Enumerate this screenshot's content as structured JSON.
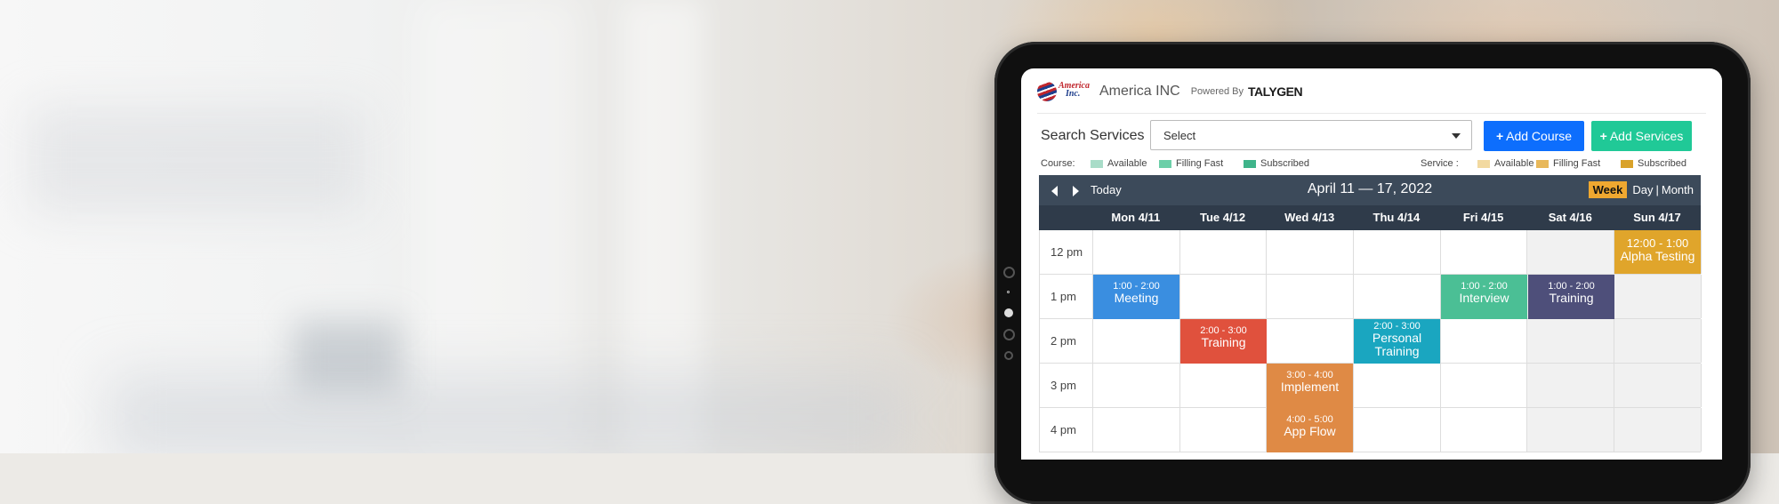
{
  "app": {
    "company": "America INC",
    "logo_top": "America",
    "logo_bottom": "Inc.",
    "powered_by": "Powered By",
    "brand": "TALYGEN"
  },
  "search": {
    "label": "Search Services",
    "select_value": "Select"
  },
  "buttons": {
    "add_course": "Add Course",
    "add_services": "Add Services",
    "plus": "+"
  },
  "legend": {
    "course_label": "Course:",
    "service_label": "Service :",
    "course_items": [
      {
        "label": "Available",
        "color": "#a8dcc8"
      },
      {
        "label": "Filling Fast",
        "color": "#6ccfa8"
      },
      {
        "label": "Subscribed",
        "color": "#3fb48a"
      }
    ],
    "service_items": [
      {
        "label": "Available",
        "color": "#f2d9a0"
      },
      {
        "label": "Filling Fast",
        "color": "#e8b85a"
      },
      {
        "label": "Subscribed",
        "color": "#d9a22a"
      }
    ]
  },
  "calendar": {
    "today": "Today",
    "range": "April 11 — 17, 2022",
    "views": {
      "week": "Week",
      "day": "Day",
      "sep": "|",
      "month": "Month"
    },
    "days": [
      "Mon 4/11",
      "Tue 4/12",
      "Wed 4/13",
      "Thu 4/14",
      "Fri 4/15",
      "Sat 4/16",
      "Sun 4/17"
    ],
    "times": [
      "12 pm",
      "1 pm",
      "2 pm",
      "3 pm",
      "4 pm"
    ],
    "events": [
      {
        "time": "12:00 - 1:00",
        "name": "Alpha Testing",
        "color": "#e0a52b"
      },
      {
        "time": "1:00 - 2:00",
        "name": "Meeting",
        "color": "#3a8ee0"
      },
      {
        "time": "1:00 - 2:00",
        "name": "Interview",
        "color": "#4bbf95"
      },
      {
        "time": "1:00 - 2:00",
        "name": "Training",
        "color": "#4e4f7a"
      },
      {
        "time": "2:00 - 3:00",
        "name": "Training",
        "color": "#e0513d"
      },
      {
        "time": "2:00 - 3:00",
        "name": "Personal Training",
        "color": "#1aa6c0"
      },
      {
        "time": "3:00 - 4:00",
        "name": "Implement",
        "color": "#df8a45"
      },
      {
        "time": "4:00 - 5:00",
        "name": "App Flow",
        "color": "#df8a45"
      }
    ]
  }
}
